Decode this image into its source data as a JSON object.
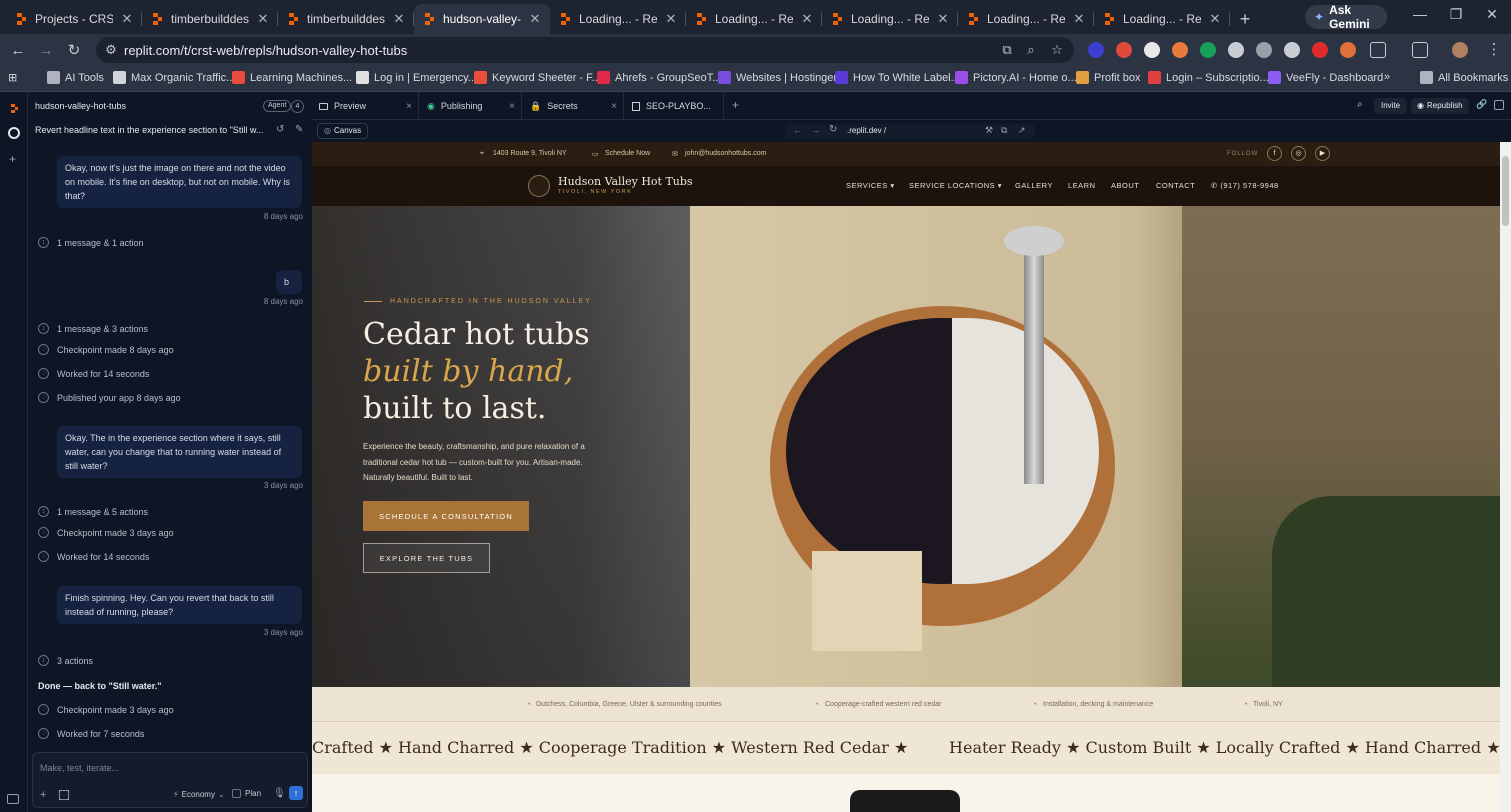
{
  "browser": {
    "tabs": [
      {
        "title": "Projects - CRST We",
        "active": false
      },
      {
        "title": "timberbuilddesign",
        "active": false
      },
      {
        "title": "timberbuilddesign",
        "active": false
      },
      {
        "title": "hudson-valley-hot-",
        "active": true
      },
      {
        "title": "Loading... - Replit",
        "active": false
      },
      {
        "title": "Loading... - Replit",
        "active": false
      },
      {
        "title": "Loading... - Replit",
        "active": false
      },
      {
        "title": "Loading... - Replit",
        "active": false
      },
      {
        "title": "Loading... - Replit",
        "active": false
      }
    ],
    "gemini_label": "Ask Gemini",
    "url": "replit.com/t/crst-web/repls/hudson-valley-hot-tubs",
    "bookmarks": [
      {
        "label": "AI Tools",
        "icon": "folder-icon",
        "color": "#aeb3bf"
      },
      {
        "label": "Max Organic Traffic...",
        "icon": "globe-icon",
        "color": "#d0d4dc"
      },
      {
        "label": "Learning Machines...",
        "icon": "sk-icon",
        "color": "#e64b3c"
      },
      {
        "label": "Log in | Emergency...",
        "icon": "shield-icon",
        "color": "#e0e0e0"
      },
      {
        "label": "Keyword Sheeter - F...",
        "icon": "sheet-icon",
        "color": "#e8503a"
      },
      {
        "label": "Ahrefs - GroupSeoT...",
        "icon": "ahrefs-icon",
        "color": "#e0284a"
      },
      {
        "label": "Websites | Hostinger",
        "icon": "hostinger-icon",
        "color": "#7a4ce0"
      },
      {
        "label": "How To White Label...",
        "icon": "lp-icon",
        "color": "#5b3bd6"
      },
      {
        "label": "Pictory.AI - Home o...",
        "icon": "pictory-icon",
        "color": "#9b4de8"
      },
      {
        "label": "Profit box",
        "icon": "profit-icon",
        "color": "#e0a040"
      },
      {
        "label": "Login – Subscriptio...",
        "icon": "cap-icon",
        "color": "#e04040"
      },
      {
        "label": "VeeFly - Dashboard",
        "icon": "veefly-icon",
        "color": "#8a5cf0"
      }
    ],
    "more_bookmarks": "»",
    "all_bookmarks": "All Bookmarks"
  },
  "replit": {
    "project_name": "hudson-valley-hot-tubs",
    "agent_label": "Agent",
    "agent_count": "4",
    "thread_title": "Revert headline text in the experience section to \"Still w...",
    "messages": [
      {
        "type": "user",
        "text": "Okay, now it's just the image on there and not the video on mobile. It's fine on desktop, but not on mobile. Why is that?",
        "time": "8 days ago"
      },
      {
        "type": "action",
        "text": "1 message & 1 action"
      },
      {
        "type": "user",
        "text": "b",
        "time": "8 days ago"
      },
      {
        "type": "action",
        "text": "1 message & 3 actions"
      },
      {
        "type": "status",
        "text": "Checkpoint made 8 days ago"
      },
      {
        "type": "status",
        "text": "Worked for 14 seconds"
      },
      {
        "type": "status",
        "text": "Published your app 8 days ago"
      },
      {
        "type": "user",
        "text": "Okay. The in the experience section where it says, still water, can you change that to running water instead of still water?",
        "time": "3 days ago"
      },
      {
        "type": "action",
        "text": "1 message & 5 actions"
      },
      {
        "type": "status",
        "text": "Checkpoint made 3 days ago"
      },
      {
        "type": "status",
        "text": "Worked for 14 seconds"
      },
      {
        "type": "user",
        "text": "Finish spinning. Hey. Can you revert that back to still instead of running, please?",
        "time": "3 days ago"
      },
      {
        "type": "action",
        "text": "3 actions"
      },
      {
        "type": "agent",
        "text": "Done — back to \"Still water.\""
      },
      {
        "type": "status",
        "text": "Checkpoint made 3 days ago"
      },
      {
        "type": "status",
        "text": "Worked for 7 seconds"
      }
    ],
    "input_placeholder": "Make, test, iterate...",
    "mode_label": "Economy",
    "plan_label": "Plan",
    "pane_tabs": [
      "Preview",
      "Publishing",
      "Secrets",
      "SEO-PLAYBO..."
    ],
    "invite_label": "Invite",
    "republish_label": "Republish",
    "canvas_label": "Canvas",
    "preview_url": ".replit.dev /"
  },
  "site": {
    "address": "1403 Route 9, Tivoli NY",
    "schedule": "Schedule Now",
    "email": "john@hudsonhottubs.com",
    "follow": "FOLLOW",
    "brand_name": "Hudson Valley Hot Tubs",
    "brand_sub": "TIVOLI, NEW YORK",
    "nav": [
      "SERVICES",
      "SERVICE LOCATIONS",
      "GALLERY",
      "LEARN",
      "ABOUT",
      "CONTACT"
    ],
    "phone": "(917) 578-9948",
    "eyebrow": "HANDCRAFTED IN THE HUDSON VALLEY",
    "headline_1": "Cedar hot tubs",
    "headline_2": "built by hand,",
    "headline_3": "built to last.",
    "hero_body": "Experience the beauty, craftsmanship, and pure relaxation of a traditional cedar hot tub — custom-built for you. Artisan-made. Naturally beautiful. Built to last.",
    "cta_primary": "SCHEDULE A CONSULTATION",
    "cta_secondary": "EXPLORE THE TUBS",
    "features": [
      "Dutchess, Columbia, Greene, Ulster & surrounding counties",
      "Cooperage-crafted western red cedar",
      "Installation, decking & maintenance",
      "Tivoli, NY"
    ],
    "marquee": "Crafted ★ Hand Charred ★ Cooperage Tradition ★ Western Red Cedar ★        Heater Ready ★ Custom Built ★ Locally Crafted ★ Hand Charred ★ Cooperage Trad"
  },
  "colors": {
    "accent_gold": "#c99a4e",
    "cta_brown": "#a87437",
    "site_dark": "#1b130c",
    "replit_bg": "#0e1525",
    "send_blue": "#2f6fd6"
  }
}
